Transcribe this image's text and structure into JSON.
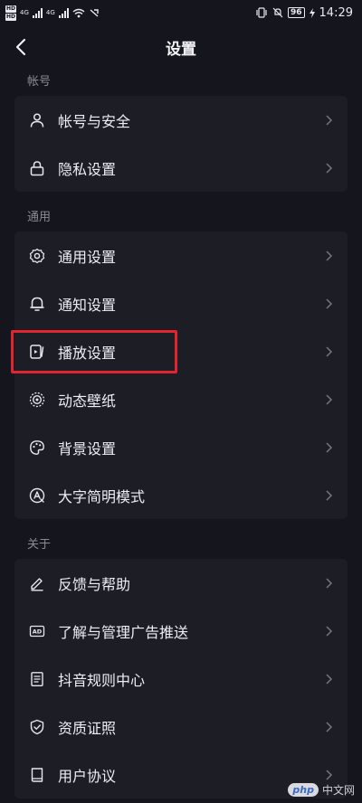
{
  "status_bar": {
    "hd1": "HD",
    "hd2": "HD",
    "net1": "4G",
    "net2": "4G",
    "battery": "96",
    "time": "14:29"
  },
  "nav": {
    "title": "设置"
  },
  "sections": [
    {
      "label": "帐号",
      "items": [
        {
          "label": "帐号与安全",
          "icon": "person-icon"
        },
        {
          "label": "隐私设置",
          "icon": "lock-icon"
        }
      ]
    },
    {
      "label": "通用",
      "items": [
        {
          "label": "通用设置",
          "icon": "gear-icon"
        },
        {
          "label": "通知设置",
          "icon": "bell-icon"
        },
        {
          "label": "播放设置",
          "icon": "playback-icon",
          "highlighted": true
        },
        {
          "label": "动态壁纸",
          "icon": "wallpaper-icon"
        },
        {
          "label": "背景设置",
          "icon": "palette-icon"
        },
        {
          "label": "大字简明模式",
          "icon": "large-text-icon"
        }
      ]
    },
    {
      "label": "关于",
      "items": [
        {
          "label": "反馈与帮助",
          "icon": "pen-icon"
        },
        {
          "label": "了解与管理广告推送",
          "icon": "ad-icon"
        },
        {
          "label": "抖音规则中心",
          "icon": "rules-icon"
        },
        {
          "label": "资质证照",
          "icon": "shield-icon"
        },
        {
          "label": "用户协议",
          "icon": "book-icon"
        }
      ]
    }
  ],
  "watermark": {
    "logo": "php",
    "text": "中文网"
  },
  "colors": {
    "background": "#15151d",
    "card": "#1d1d26",
    "highlight": "#e1242e",
    "section_label": "#8a8a93"
  }
}
